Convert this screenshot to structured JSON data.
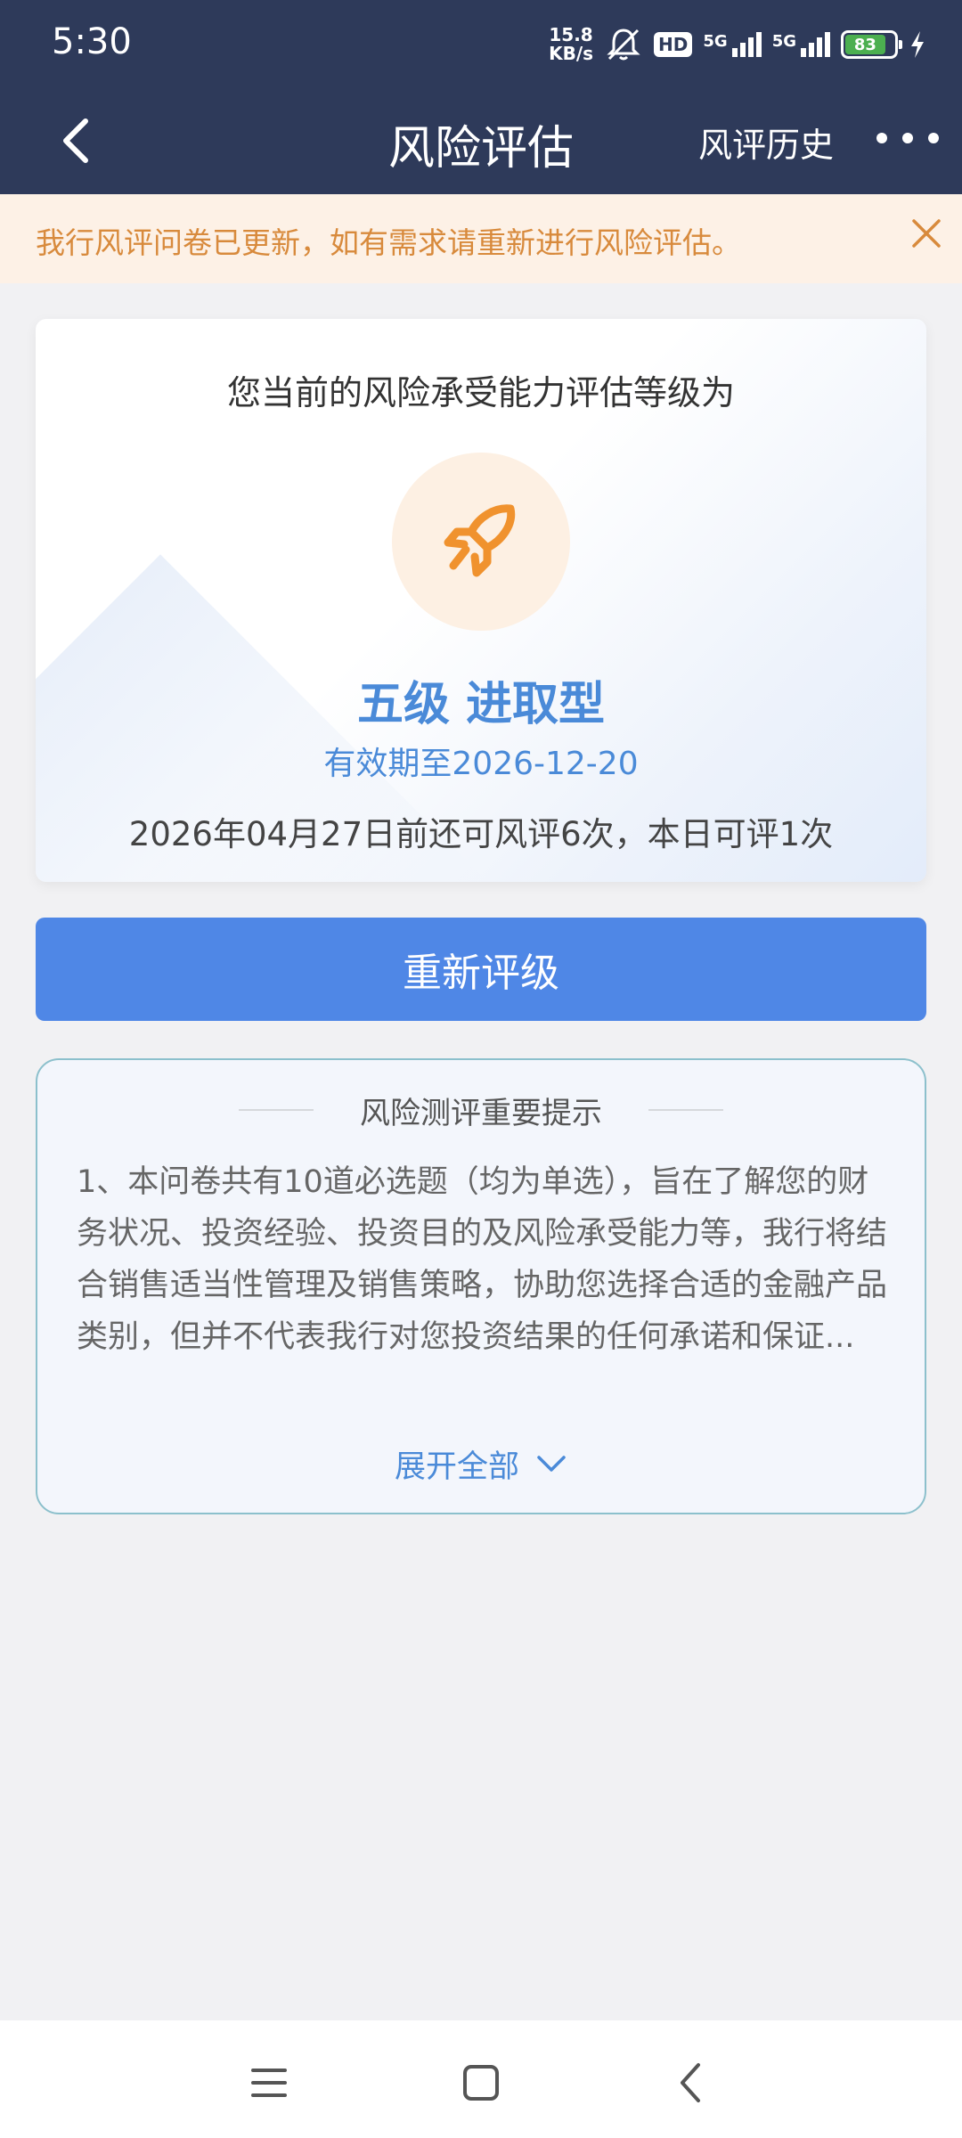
{
  "status_bar": {
    "time": "5:30",
    "net_speed_value": "15.8",
    "net_speed_unit": "KB/s",
    "hd_label": "HD",
    "signal_1_label": "5G",
    "signal_2_label": "5G",
    "battery_level": "83",
    "battery_color": "#4caf50"
  },
  "nav": {
    "title": "风险评估",
    "history_label": "风评历史"
  },
  "notice": {
    "text": "我行风评问卷已更新，如有需求请重新进行风险评估。"
  },
  "grade_card": {
    "title": "您当前的风险承受能力评估等级为",
    "icon": "rocket-icon",
    "level": "五级 进取型",
    "valid_until": "有效期至2026-12-20",
    "remaining": "2026年04月27日前还可风评6次，本日可评1次"
  },
  "regrade_button": {
    "label": "重新评级"
  },
  "tips": {
    "title": "风险测评重要提示",
    "body": "1、本问卷共有10道必选题（均为单选），旨在了解您的财务状况、投资经验、投资目的及风险承受能力等，我行将结合销售适当性管理及销售策略，协助您选择合适的金融产品类别，但并不代表我行对您投资结果的任何承诺和保证...",
    "expand_label": "展开全部"
  },
  "colors": {
    "header_bg": "#2e3a5a",
    "accent_blue": "#4f87e6",
    "notice_orange": "#d88a3c"
  }
}
